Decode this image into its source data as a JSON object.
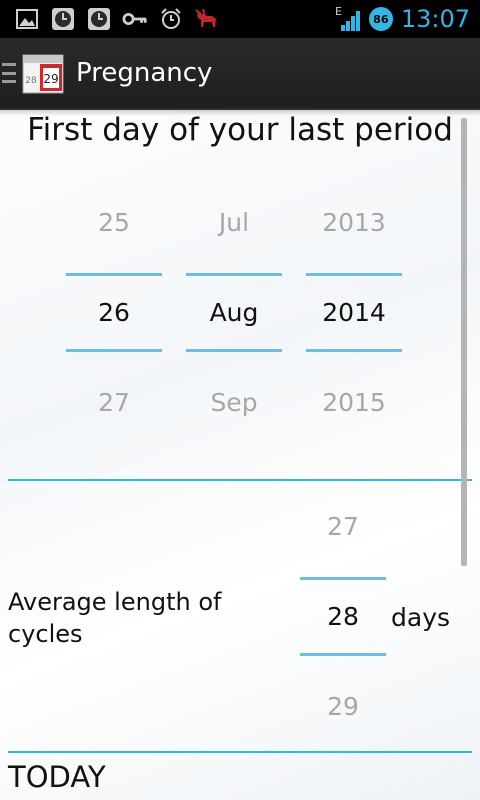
{
  "status_bar": {
    "time": "13:07",
    "battery": "86",
    "network": "E",
    "icons": [
      "gallery-icon",
      "clock-icon",
      "clock-icon",
      "key-icon",
      "alarm-icon",
      "moose-icon"
    ]
  },
  "action_bar": {
    "app_icon_day": "29",
    "app_icon_side": "28",
    "title": "Pregnancy"
  },
  "period": {
    "title": "First day of your last period",
    "day": {
      "prev": "25",
      "current": "26",
      "next": "27"
    },
    "month": {
      "prev": "Jul",
      "current": "Aug",
      "next": "Sep"
    },
    "year": {
      "prev": "2013",
      "current": "2014",
      "next": "2015"
    }
  },
  "cycle": {
    "label": "Average length of cycles",
    "prev": "27",
    "current": "28",
    "next": "29",
    "unit": "days"
  },
  "today_label": "TODAY",
  "colors": {
    "accent": "#33b5e5",
    "picker_line": "#6bbde3",
    "action_bar": "#222222"
  }
}
